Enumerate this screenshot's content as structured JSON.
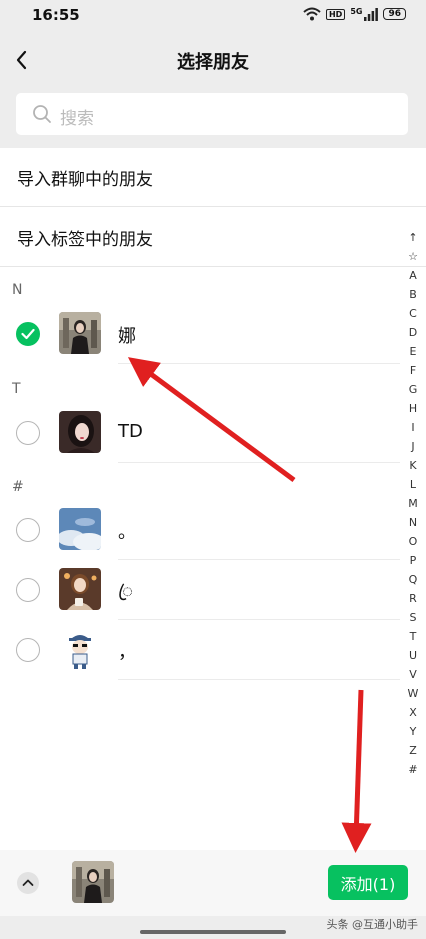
{
  "status_bar": {
    "time": "16:55",
    "network": "5G",
    "hd": "HD",
    "battery": "96"
  },
  "nav": {
    "title": "选择朋友"
  },
  "search": {
    "placeholder": "搜索"
  },
  "import_options": [
    "导入群聊中的朋友",
    "导入标签中的朋友"
  ],
  "sections": [
    {
      "letter": "N",
      "contacts": [
        {
          "name": "娜",
          "selected": true,
          "avatar": "avatar-woman-dark-dress"
        }
      ]
    },
    {
      "letter": "T",
      "contacts": [
        {
          "name": "TD",
          "selected": false,
          "avatar": "avatar-woman-portrait"
        }
      ]
    },
    {
      "letter": "#",
      "contacts": [
        {
          "name": "。",
          "selected": false,
          "avatar": "avatar-sky-clouds"
        },
        {
          "name": "ꦿ",
          "selected": false,
          "avatar": "avatar-woman-cup"
        },
        {
          "name": "，",
          "selected": false,
          "avatar": "avatar-cartoon-boy"
        }
      ]
    }
  ],
  "index_letters": [
    "↑",
    "☆",
    "A",
    "B",
    "C",
    "D",
    "E",
    "F",
    "G",
    "H",
    "I",
    "J",
    "K",
    "L",
    "M",
    "N",
    "O",
    "P",
    "Q",
    "R",
    "S",
    "T",
    "U",
    "V",
    "W",
    "X",
    "Y",
    "Z",
    "#"
  ],
  "bottom_bar": {
    "add_label": "添加(1)",
    "selected_avatar": "avatar-woman-dark-dress"
  },
  "watermark": "头条 @互通小助手",
  "colors": {
    "accent": "#07c160",
    "annotation": "#e02020",
    "background": "#ededed"
  }
}
